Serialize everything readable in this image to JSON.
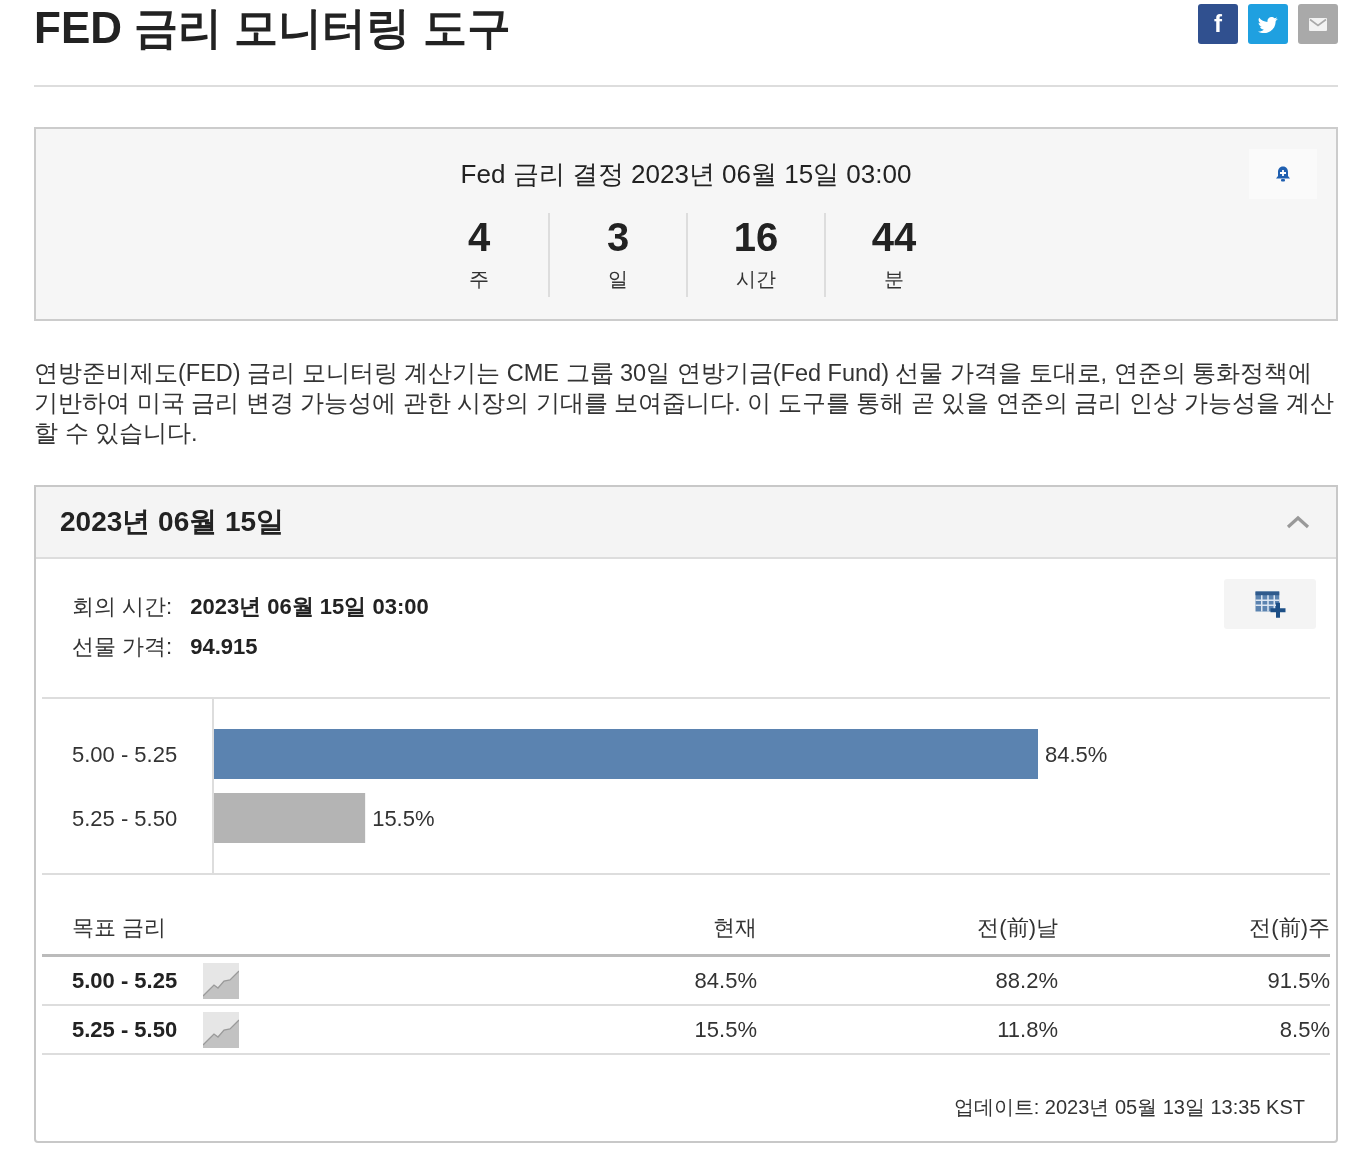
{
  "page": {
    "title": "FED 금리 모니터링 도구",
    "share_buttons": [
      {
        "kind": "facebook",
        "glyph": "f"
      },
      {
        "kind": "twitter"
      },
      {
        "kind": "email"
      }
    ]
  },
  "countdown": {
    "title": "Fed 금리 결정 2023년 06월 15일 03:00",
    "units": [
      {
        "value": "4",
        "label": "주"
      },
      {
        "value": "3",
        "label": "일"
      },
      {
        "value": "16",
        "label": "시간"
      },
      {
        "value": "44",
        "label": "분"
      }
    ]
  },
  "description": "연방준비제도(FED) 금리 모니터링 계산기는 CME 그룹 30일 연방기금(Fed Fund) 선물 가격을 토대로, 연준의 통화정책에 기반하여 미국 금리 변경 가능성에 관한 시장의 기대를 보여줍니다. 이 도구를 통해 곧 있을 연준의 금리 인상 가능성을 계산할 수 있습니다.",
  "meeting": {
    "title": "2023년 06월 15일",
    "expanded": true,
    "info": [
      {
        "label": "회의 시간:",
        "value": "2023년 06월 15일 03:00"
      },
      {
        "label": "선물 가격:",
        "value": "94.915"
      }
    ],
    "chart_data": {
      "type": "bar",
      "orientation": "horizontal",
      "categories": [
        "5.00 - 5.25",
        "5.25 - 5.50"
      ],
      "values": [
        84.5,
        15.5
      ],
      "value_labels": [
        "84.5%",
        "15.5%"
      ]
    },
    "table": {
      "columns": [
        "목표 금리",
        "현재",
        "전(前)날",
        "전(前)주"
      ],
      "rows": [
        {
          "cells": [
            "5.00 - 5.25",
            "84.5%",
            "88.2%",
            "91.5%"
          ]
        },
        {
          "cells": [
            "5.25 - 5.50",
            "15.5%",
            "11.8%",
            "8.5%"
          ]
        }
      ]
    },
    "updated": "업데이트: 2023년 05월 13일 13:35 KST"
  }
}
